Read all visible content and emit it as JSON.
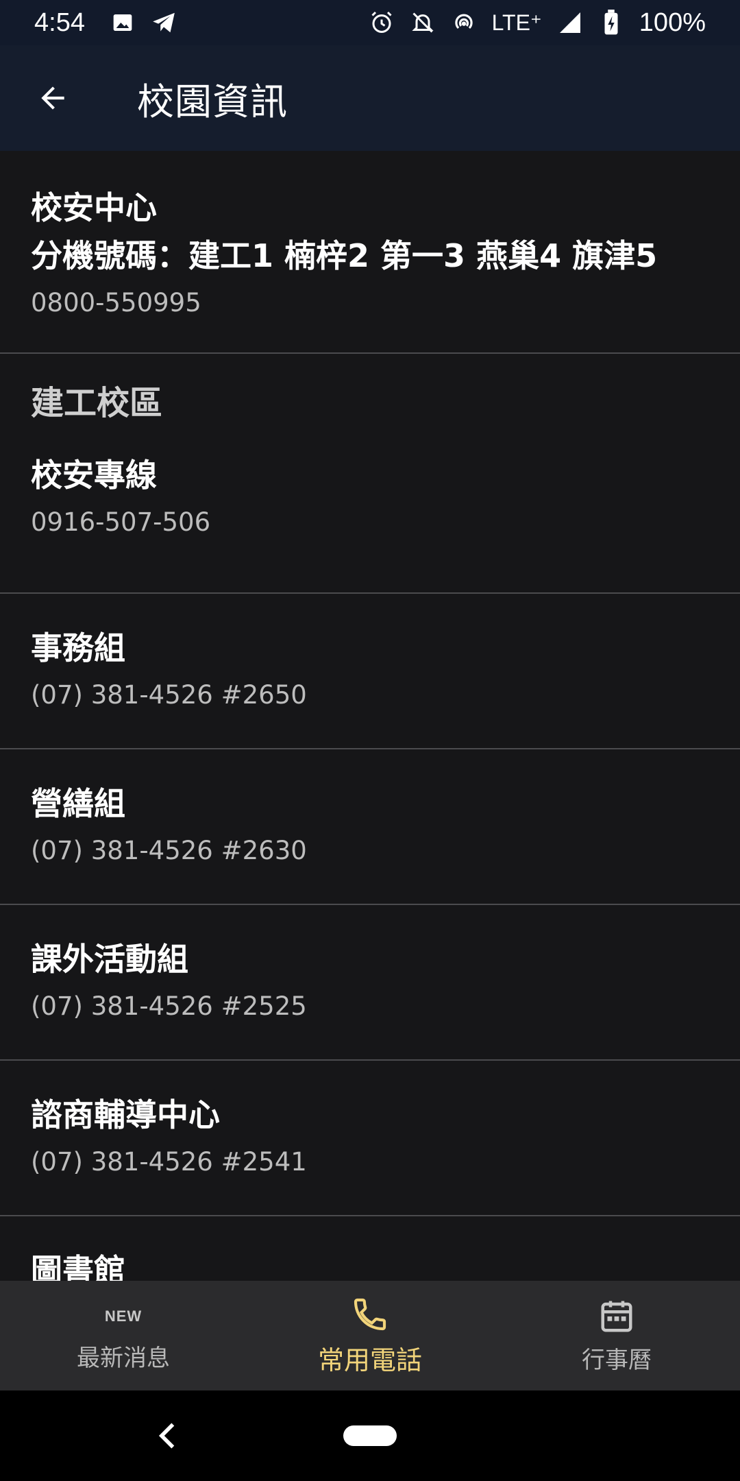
{
  "status": {
    "time": "4:54",
    "network": "LTE⁺",
    "battery": "100%"
  },
  "app_bar": {
    "title": "校園資訊"
  },
  "list": {
    "first": {
      "title_line1": "校安中心",
      "title_line2": "分機號碼：建工1 楠梓2 第一3 燕巢4 旗津5",
      "phone": "0800-550995"
    },
    "section": "建工校區",
    "section_item": {
      "title": "校安專線",
      "phone": "0916-507-506"
    },
    "items": [
      {
        "title": "事務組",
        "phone": "(07) 381-4526 #2650"
      },
      {
        "title": "營繕組",
        "phone": "(07) 381-4526 #2630"
      },
      {
        "title": "課外活動組",
        "phone": "(07) 381-4526 #2525"
      },
      {
        "title": "諮商輔導中心",
        "phone": "(07) 381-4526 #2541"
      },
      {
        "title": "圖書館",
        "phone": ""
      }
    ]
  },
  "bottom_nav": {
    "items": [
      {
        "label": "最新消息",
        "icon": "new-icon",
        "badge": "NEW"
      },
      {
        "label": "常用電話",
        "icon": "phone-icon",
        "active": true
      },
      {
        "label": "行事曆",
        "icon": "calendar-icon"
      }
    ],
    "active_color": "#f2d47a"
  }
}
